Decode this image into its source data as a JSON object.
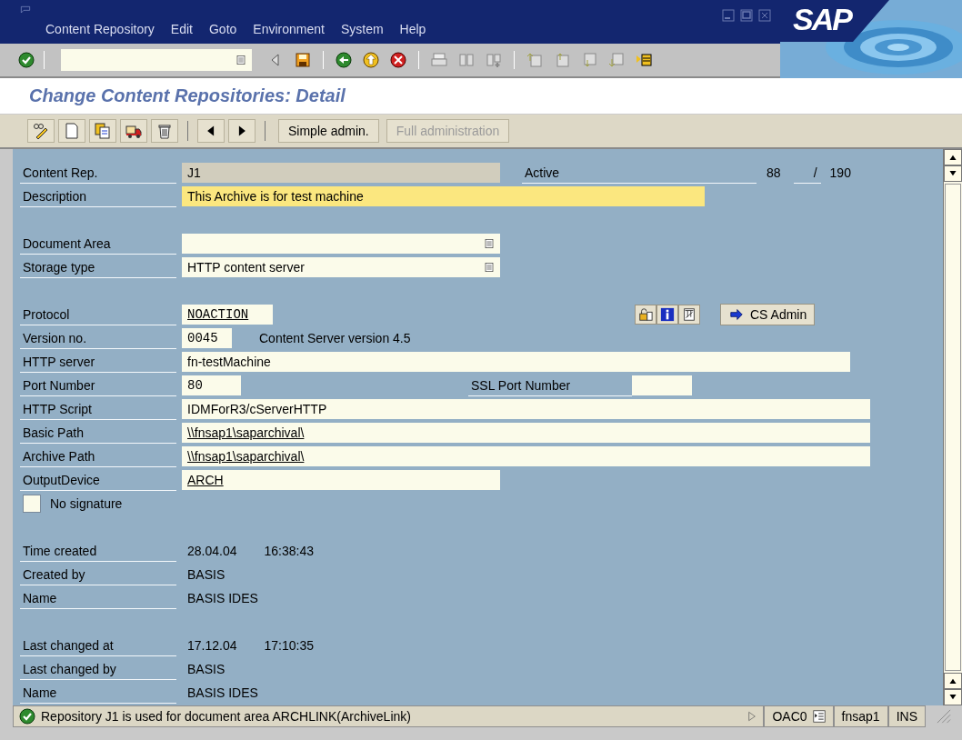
{
  "menu_bar": {
    "items": [
      {
        "label": "Content Repository"
      },
      {
        "label": "Edit"
      },
      {
        "label": "Goto"
      },
      {
        "label": "Environment"
      },
      {
        "label": "System"
      },
      {
        "label": "Help"
      }
    ],
    "logo": "SAP"
  },
  "title": "Change Content Repositories: Detail",
  "app_toolbar": {
    "buttons": [
      {
        "label": "Simple admin.",
        "disabled": false
      },
      {
        "label": "Full administration",
        "disabled": true
      }
    ]
  },
  "groups": [
    [
      {
        "kind": "repository",
        "label": "Content Rep.",
        "value": "J1",
        "status": "Active",
        "count": "88",
        "separator": "/",
        "total": "190"
      },
      {
        "kind": "description",
        "label": "Description",
        "value": "This Archive is for test machine"
      }
    ],
    [
      {
        "kind": "field",
        "label": "Document Area",
        "dropdown": true
      },
      {
        "kind": "field",
        "label": "Storage type",
        "value": "HTTP content server",
        "dropdown": true
      }
    ],
    [
      {
        "kind": "protocol",
        "label": "Protocol",
        "value": "NOACTION",
        "button": "CS Admin"
      },
      {
        "kind": "version",
        "label": "Version no.",
        "value": "0045",
        "note": "Content Server version 4.5"
      },
      {
        "kind": "field",
        "label": "HTTP server",
        "value": "fn-testMachine"
      },
      {
        "kind": "port",
        "label": "Port Number",
        "value": "80",
        "ssl_label": "SSL Port Number"
      },
      {
        "kind": "field",
        "label": "HTTP Script",
        "value": "IDMForR3/cServerHTTP"
      },
      {
        "kind": "field",
        "label": "Basic Path",
        "value": "\\\\fnsap1\\saparchival\\",
        "underlined": true
      },
      {
        "kind": "field",
        "label": "Archive Path",
        "value": "\\\\fnsap1\\saparchival\\",
        "underlined": true
      },
      {
        "kind": "field",
        "label": "OutputDevice",
        "value": "ARCH",
        "underlined": true
      },
      {
        "kind": "checkbox",
        "label": "No signature",
        "checked": false
      }
    ],
    [
      {
        "kind": "info",
        "label": "Time created",
        "value": "28.04.04",
        "time": "16:38:43"
      },
      {
        "kind": "info",
        "label": "Created by",
        "value": "BASIS"
      },
      {
        "kind": "info",
        "label": "Name",
        "value": "BASIS IDES"
      }
    ],
    [
      {
        "kind": "info",
        "label": "Last changed at",
        "value": "17.12.04",
        "time": "17:10:35"
      },
      {
        "kind": "info",
        "label": "Last changed by",
        "value": "BASIS"
      },
      {
        "kind": "info",
        "label": "Name",
        "value": "BASIS IDES"
      }
    ]
  ],
  "status_bar": {
    "message": "Repository J1 is used for document area ARCHLINK(ArchiveLink)",
    "transaction": "OAC0",
    "server": "fnsap1",
    "mode": "INS"
  }
}
